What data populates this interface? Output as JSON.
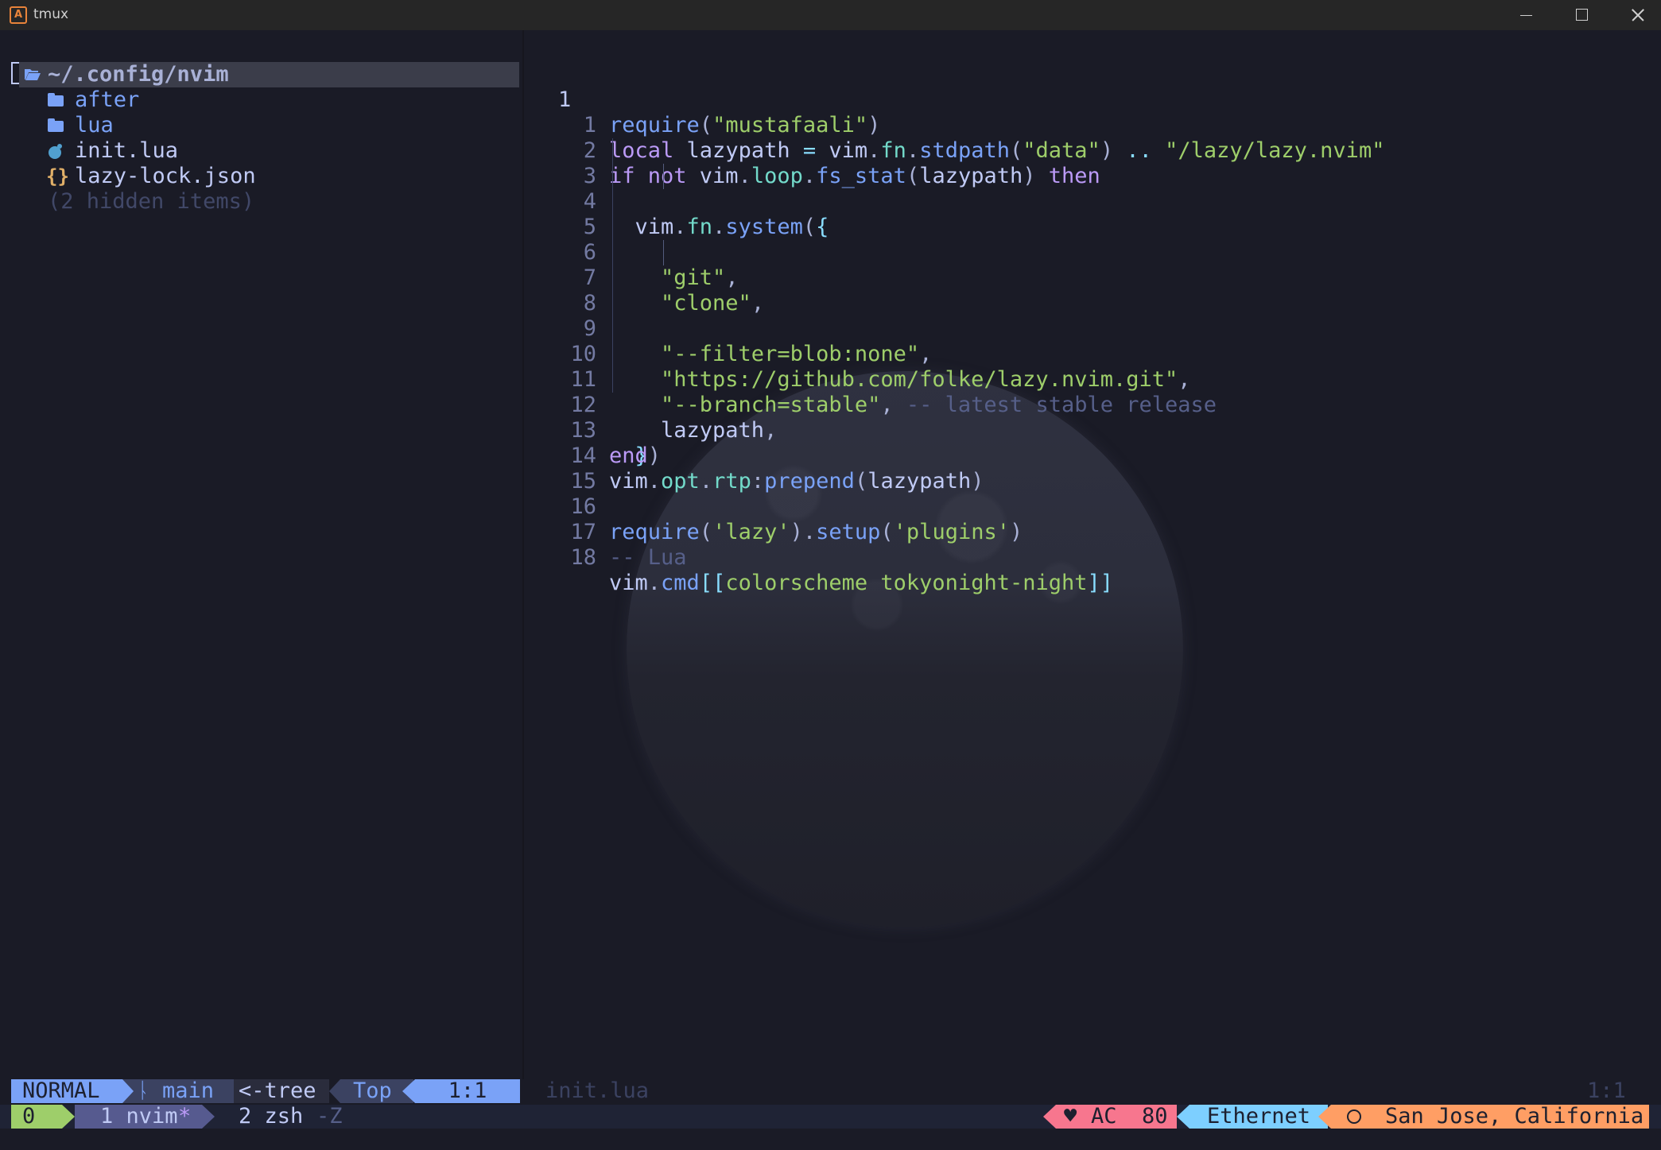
{
  "window": {
    "title": "tmux",
    "app_icon": "alacritty-icon"
  },
  "tree": {
    "root": "~/.config/nvim",
    "items": [
      {
        "label": "after",
        "icon": "folder-icon",
        "kind": "dir"
      },
      {
        "label": "lua",
        "icon": "folder-icon",
        "kind": "dir"
      },
      {
        "label": "init.lua",
        "icon": "lua-icon",
        "kind": "file"
      },
      {
        "label": "lazy-lock.json",
        "icon": "json-icon",
        "kind": "file",
        "glyph": "{}"
      }
    ],
    "hidden": "(2 hidden items)"
  },
  "editor": {
    "current_line_number": "1",
    "relative_numbers": [
      "1",
      "2",
      "3",
      "4",
      "5",
      "6",
      "7",
      "8",
      "9",
      "10",
      "11",
      "12",
      "13",
      "14",
      "15",
      "16",
      "17",
      "18"
    ],
    "lines": [
      "require(\"mustafaali\")",
      "local lazypath = vim.fn.stdpath(\"data\") .. \"/lazy/lazy.nvim\"",
      "if not vim.loop.fs_stat(lazypath) then",
      "  vim.fn.system({",
      "",
      "    \"git\",",
      "    \"clone\",",
      "",
      "    \"--filter=blob:none\",",
      "    \"https://github.com/folke/lazy.nvim.git\",",
      "    \"--branch=stable\", -- latest stable release",
      "    lazypath,",
      "  })",
      "end",
      "vim.opt.rtp:prepend(lazypath)",
      "",
      "require('lazy').setup('plugins')",
      "-- Lua",
      "vim.cmd[[colorscheme tokyonight-night]]"
    ]
  },
  "statusline": {
    "mode": "NORMAL",
    "branch_icon": "git-branch-icon",
    "branch": "main",
    "filetype": "<-tree",
    "percent": "Top",
    "location": "1:1",
    "inactive_file": "init.lua",
    "inactive_location": "1:1"
  },
  "tmux": {
    "session": "0",
    "window1": "1 nvim",
    "window1_flag": "*",
    "window2": "2 zsh",
    "window2_flag": "-Z",
    "power_icon": "heart-icon",
    "power": "AC",
    "battery": "80",
    "network": "Ethernet",
    "weather_icon": "sun-icon",
    "location": "San Jose, California"
  },
  "colors": {
    "background": "#1a1b26",
    "accent_blue": "#7aa2f7",
    "green": "#9ece6a",
    "purple": "#bb9af7",
    "pink": "#f7768e",
    "cyan": "#7dcfff",
    "orange": "#ff9e64"
  }
}
